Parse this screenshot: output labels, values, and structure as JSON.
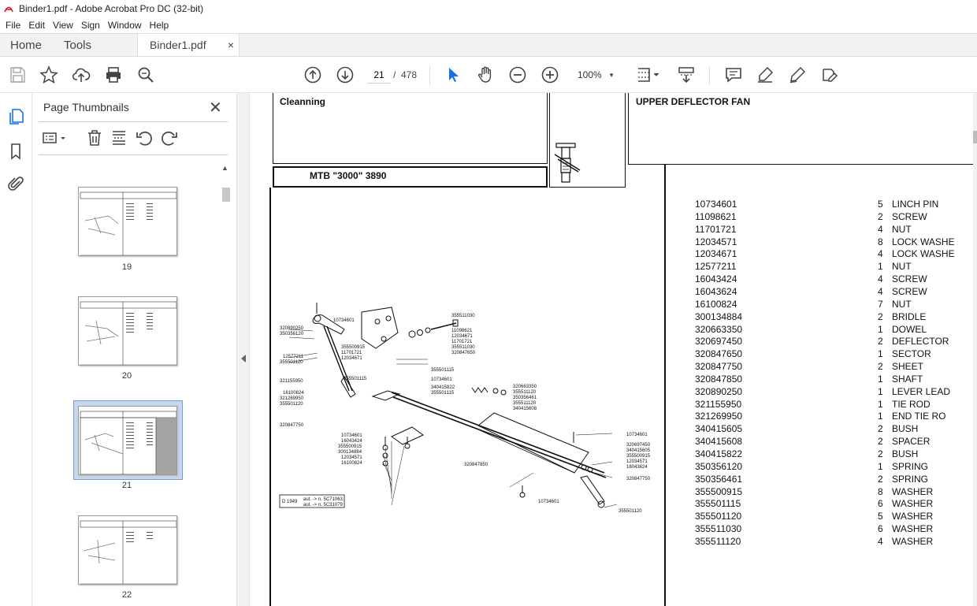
{
  "window": {
    "title": "Binder1.pdf - Adobe Acrobat Pro DC (32-bit)"
  },
  "menu": [
    "File",
    "Edit",
    "View",
    "Sign",
    "Window",
    "Help"
  ],
  "tabs": {
    "home": "Home",
    "tools": "Tools",
    "document": "Binder1.pdf",
    "close": "×"
  },
  "toolbar": {
    "page_current": "21",
    "page_separator": "/",
    "page_total": "478",
    "zoom": "100%"
  },
  "thumbnails": {
    "title": "Page Thumbnails",
    "close": "✕",
    "pages": [
      {
        "label": "19"
      },
      {
        "label": "20"
      },
      {
        "label": "21",
        "selected": true
      },
      {
        "label": "22"
      }
    ]
  },
  "document": {
    "section_title": "Cleanning",
    "model_label": "MTB \"3000\" 3890",
    "group_title": "UPPER DEFLECTOR FAN",
    "figure_labels": {
      "l1": "10734601",
      "l2": "320890250",
      "l3": "350356120",
      "l4": "355500915",
      "l5": "11701721",
      "l6": "12034671",
      "l7": "12577211",
      "l8": "355501120",
      "l9": "355511030",
      "l10": "11098621",
      "l11": "12034671",
      "l12": "11701721",
      "l13": "355511030",
      "l14": "320847650",
      "l15": "355501115",
      "l16": "10734601",
      "l17": "340415822",
      "l18": "355501115",
      "l19": "321155950",
      "l20": "355501115",
      "l21": "16100824",
      "l22": "321269950",
      "l23": "355501120",
      "l24": "320663350",
      "l25": "355511120",
      "l26": "350356461",
      "l27": "355511120",
      "l28": "340415608",
      "l29": "320847750",
      "l30": "10734601",
      "l31": "16043424",
      "l32": "355500915",
      "l33": "300134884",
      "l34": "12034571",
      "l35": "16100824",
      "l36": "320847850",
      "l37": "10734601",
      "l38": "320697450",
      "l39": "340415605",
      "l40": "355500915",
      "l41": "12034571",
      "l42": "16043624",
      "l43": "320847750",
      "l44": "10734601",
      "l45": "355501120",
      "ref_code": "D 1949",
      "ref_line1": "aut. -> n. 5C71063",
      "ref_line2": "aut. -> n. 5C31079"
    },
    "parts": [
      {
        "code": "10734601",
        "qty": "5",
        "desc": "LINCH PIN"
      },
      {
        "code": "11098621",
        "qty": "2",
        "desc": "SCREW"
      },
      {
        "code": "11701721",
        "qty": "4",
        "desc": "NUT"
      },
      {
        "code": "12034571",
        "qty": "8",
        "desc": "LOCK WASHE"
      },
      {
        "code": "12034671",
        "qty": "4",
        "desc": "LOCK WASHE"
      },
      {
        "code": "12577211",
        "qty": "1",
        "desc": "NUT"
      },
      {
        "code": "16043424",
        "qty": "4",
        "desc": "SCREW"
      },
      {
        "code": "16043624",
        "qty": "4",
        "desc": "SCREW"
      },
      {
        "code": "16100824",
        "qty": "7",
        "desc": "NUT"
      },
      {
        "code": "300134884",
        "qty": "2",
        "desc": "BRIDLE"
      },
      {
        "code": "320663350",
        "qty": "1",
        "desc": "DOWEL"
      },
      {
        "code": "320697450",
        "qty": "2",
        "desc": "DEFLECTOR"
      },
      {
        "code": "320847650",
        "qty": "1",
        "desc": "SECTOR"
      },
      {
        "code": "320847750",
        "qty": "2",
        "desc": "SHEET"
      },
      {
        "code": "320847850",
        "qty": "1",
        "desc": "SHAFT"
      },
      {
        "code": "320890250",
        "qty": "1",
        "desc": "LEVER LEAD"
      },
      {
        "code": "321155950",
        "qty": "1",
        "desc": "TIE ROD"
      },
      {
        "code": "321269950",
        "qty": "1",
        "desc": "END TIE RO"
      },
      {
        "code": "340415605",
        "qty": "2",
        "desc": "BUSH"
      },
      {
        "code": "340415608",
        "qty": "2",
        "desc": "SPACER"
      },
      {
        "code": "340415822",
        "qty": "2",
        "desc": "BUSH"
      },
      {
        "code": "350356120",
        "qty": "1",
        "desc": "SPRING"
      },
      {
        "code": "350356461",
        "qty": "2",
        "desc": "SPRING"
      },
      {
        "code": "355500915",
        "qty": "8",
        "desc": "WASHER"
      },
      {
        "code": "355501115",
        "qty": "6",
        "desc": "WASHER"
      },
      {
        "code": "355501120",
        "qty": "5",
        "desc": "WASHER"
      },
      {
        "code": "355511030",
        "qty": "6",
        "desc": "WASHER"
      },
      {
        "code": "355511120",
        "qty": "4",
        "desc": "WASHER"
      }
    ]
  }
}
